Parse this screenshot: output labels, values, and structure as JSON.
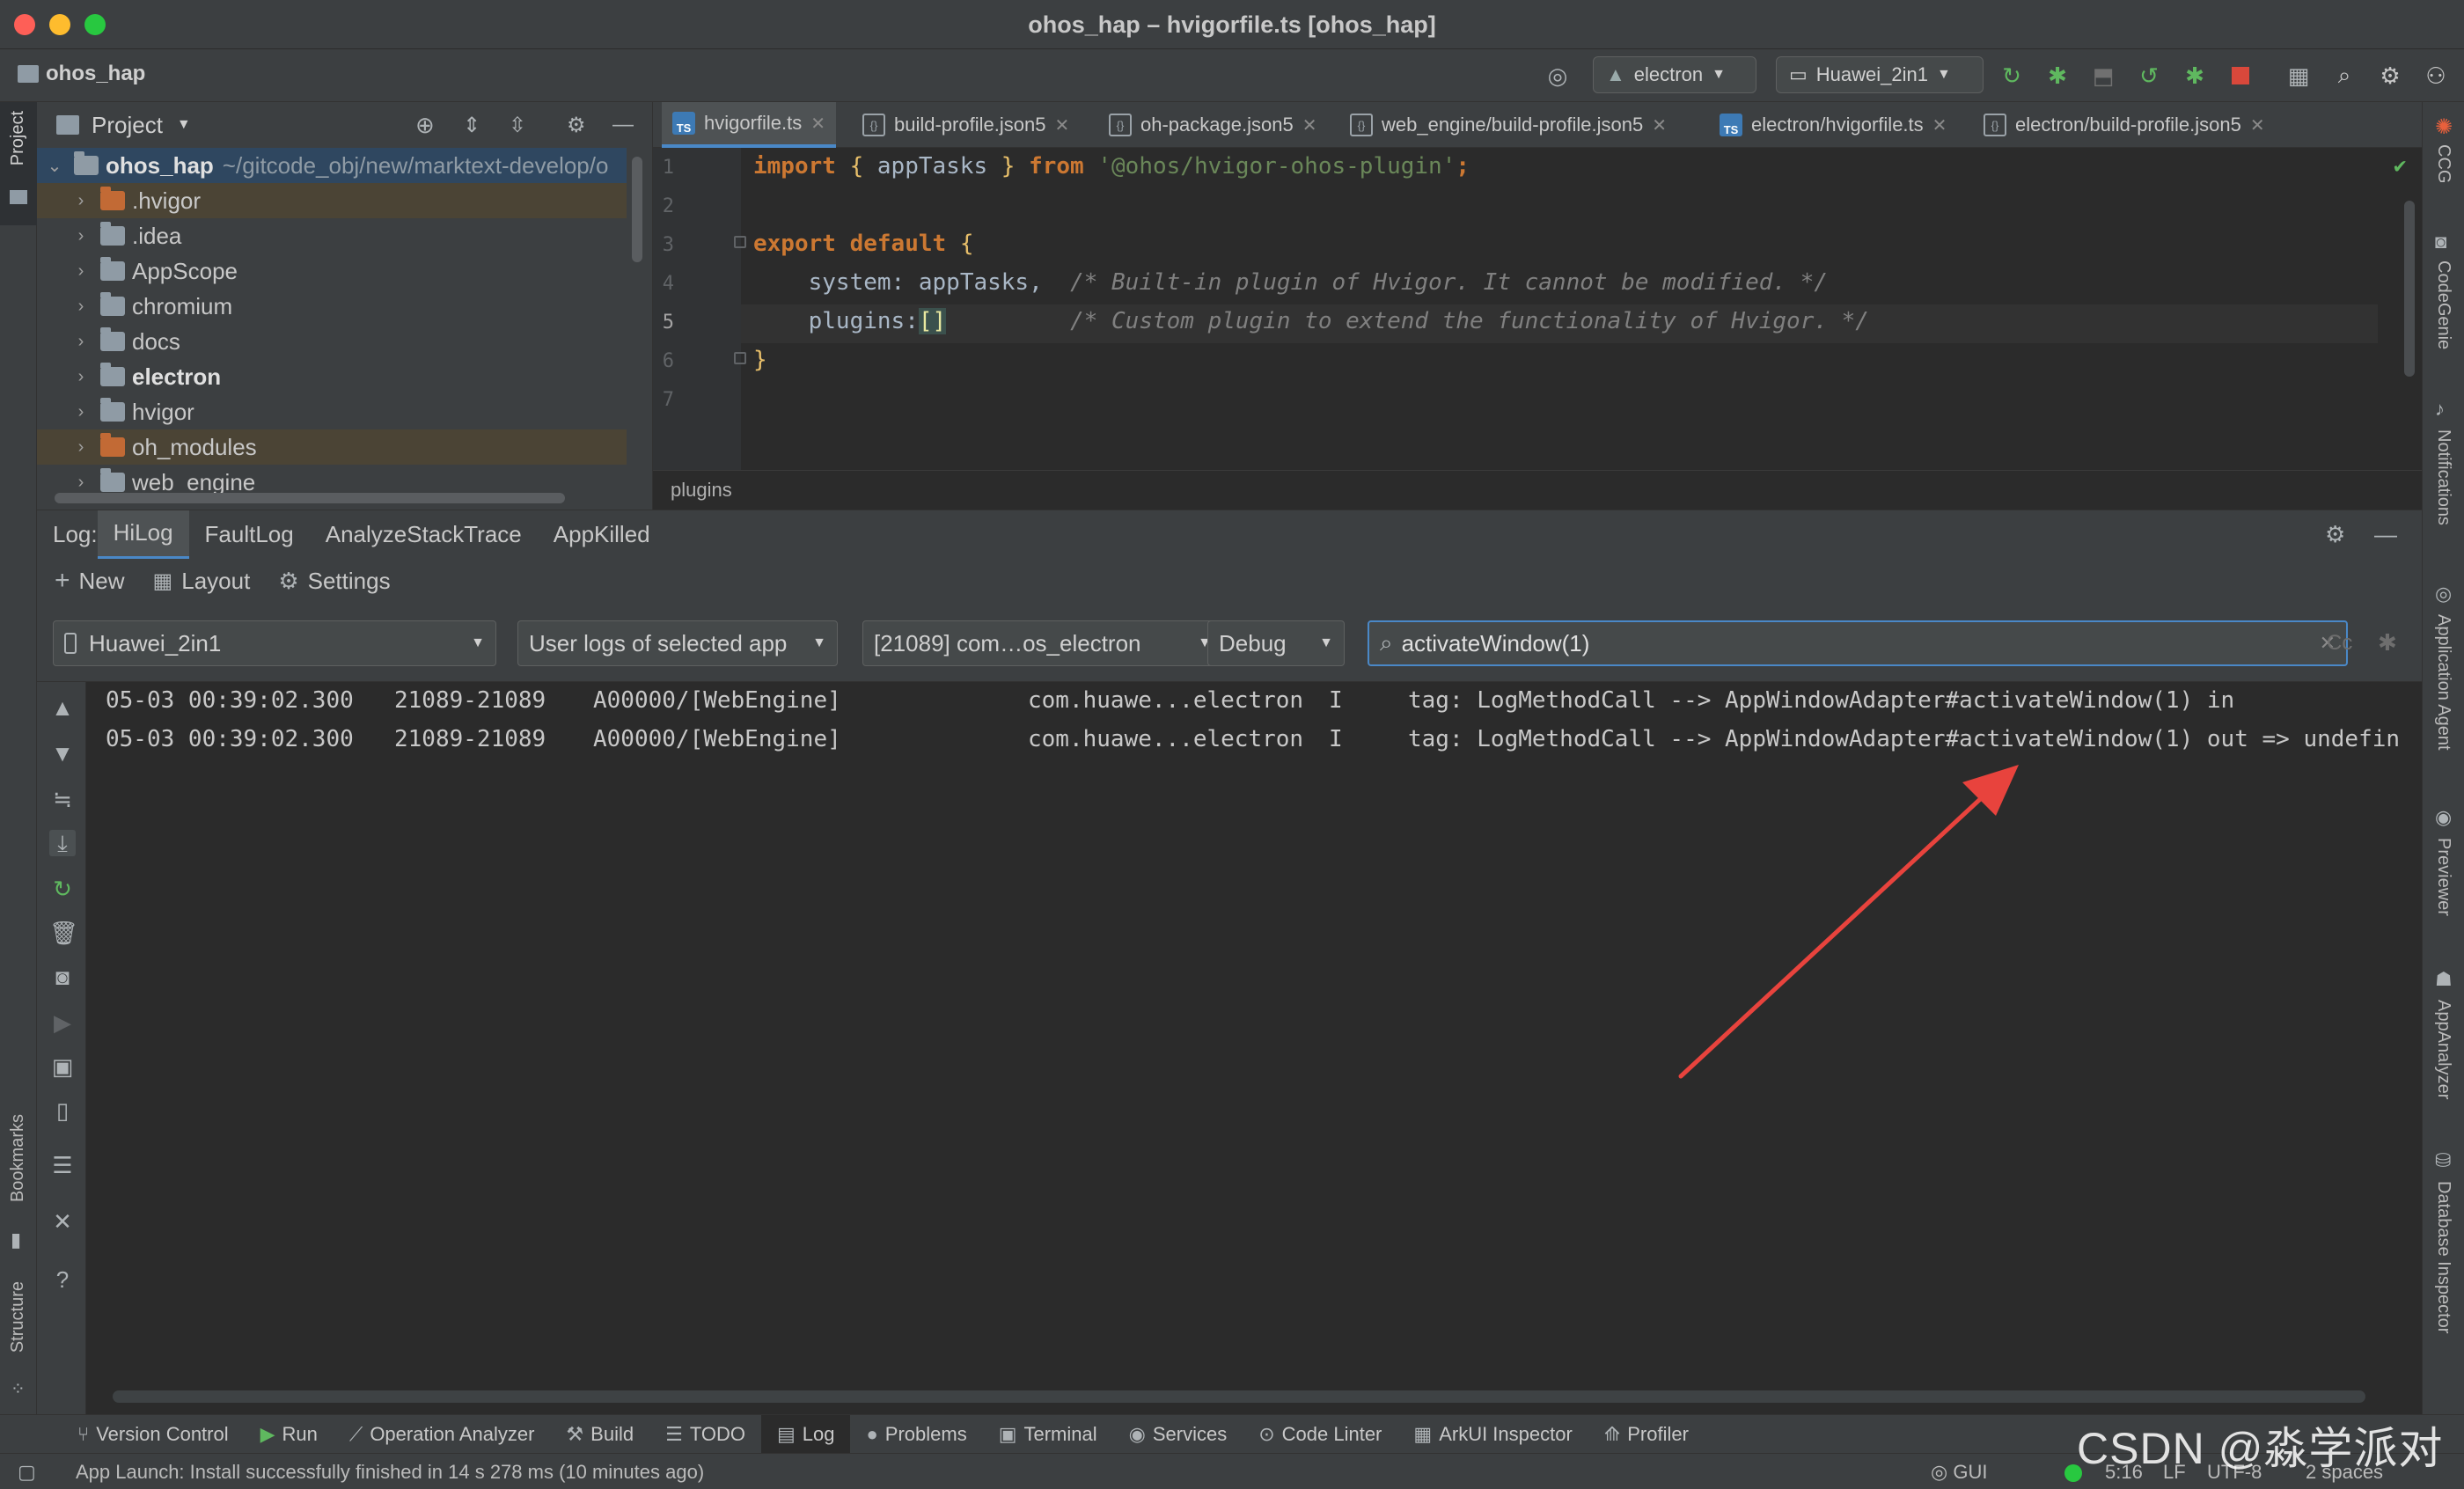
{
  "window": {
    "title": "ohos_hap – hvigorfile.ts [ohos_hap]"
  },
  "navbar": {
    "project": "ohos_hap",
    "run_config": "electron",
    "device": "Huawei_2in1"
  },
  "left_strip": {
    "project_label": "Project",
    "bookmarks_label": "Bookmarks",
    "structure_label": "Structure"
  },
  "right_strip": {
    "items": [
      "CCG",
      "CodeGenie",
      "Notifications",
      "Application Agent",
      "Previewer",
      "AppAnalyzer",
      "Database Inspector"
    ]
  },
  "project_panel": {
    "title": "Project",
    "root_name": "ohos_hap",
    "root_path": "~/gitcode_obj/new/marktext-develop/o",
    "items": [
      {
        "label": ".hvigor",
        "bold": false
      },
      {
        "label": ".idea",
        "bold": false
      },
      {
        "label": "AppScope",
        "bold": false
      },
      {
        "label": "chromium",
        "bold": false
      },
      {
        "label": "docs",
        "bold": false
      },
      {
        "label": "electron",
        "bold": true
      },
      {
        "label": "hvigor",
        "bold": false
      },
      {
        "label": "oh_modules",
        "bold": false
      },
      {
        "label": "web_engine",
        "bold": false
      }
    ]
  },
  "editor_tabs": [
    "hvigorfile.ts",
    "build-profile.json5",
    "oh-package.json5",
    "web_engine/build-profile.json5",
    "electron/hvigorfile.ts",
    "electron/build-profile.json5"
  ],
  "editor": {
    "line_numbers": [
      "1",
      "2",
      "3",
      "4",
      "5",
      "6",
      "7"
    ],
    "line1": {
      "kw1": "import",
      "ob": "{",
      "name": "appTasks",
      "cb": "}",
      "kw2": "from",
      "str": "'@ohos/hvigor-ohos-plugin'",
      "end": ";"
    },
    "line3": {
      "kw1": "export",
      "kw2": "default",
      "ob": "{"
    },
    "line4": {
      "key": "system",
      "colon": ":",
      "val": "appTasks,",
      "comment": "/* Built-in plugin of Hvigor. It cannot be modified. */"
    },
    "line5": {
      "key": "plugins",
      "colon": ":",
      "val": "[]",
      "comment": "/* Custom plugin to extend the functionality of Hvigor. */"
    },
    "line6": {
      "cb": "}"
    },
    "breadcrumb": "plugins"
  },
  "log": {
    "label": "Log:",
    "tabs": [
      "HiLog",
      "FaultLog",
      "AnalyzeStackTrace",
      "AppKilled"
    ],
    "toolbar": {
      "new": "New",
      "layout": "Layout",
      "settings": "Settings"
    },
    "filters": {
      "device": "Huawei_2in1",
      "scope": "User logs of selected app",
      "process": "[21089] com…os_electron",
      "level": "Debug",
      "search": "activateWindow(1)",
      "case_toggle": "Cc"
    },
    "lines": [
      {
        "time": "05-03 00:39:02.300",
        "pid": "21089-21089",
        "domain": "A00000/[WebEngine]",
        "pkg": "com.huawe...electron",
        "level": "I",
        "msg": "tag: LogMethodCall --> AppWindowAdapter#activateWindow(1) in"
      },
      {
        "time": "05-03 00:39:02.300",
        "pid": "21089-21089",
        "domain": "A00000/[WebEngine]",
        "pkg": "com.huawe...electron",
        "level": "I",
        "msg": "tag: LogMethodCall --> AppWindowAdapter#activateWindow(1) out => undefin"
      }
    ]
  },
  "bottom_bar": [
    {
      "label": "Version Control",
      "icon": "branch-icon"
    },
    {
      "label": "Run",
      "icon": "play-icon"
    },
    {
      "label": "Operation Analyzer",
      "icon": "chart-icon"
    },
    {
      "label": "Build",
      "icon": "hammer-icon"
    },
    {
      "label": "TODO",
      "icon": "list-icon"
    },
    {
      "label": "Log",
      "icon": "log-icon"
    },
    {
      "label": "Problems",
      "icon": "info-icon"
    },
    {
      "label": "Terminal",
      "icon": "terminal-icon"
    },
    {
      "label": "Services",
      "icon": "services-icon"
    },
    {
      "label": "Code Linter",
      "icon": "linter-icon"
    },
    {
      "label": "ArkUI Inspector",
      "icon": "inspector-icon"
    },
    {
      "label": "Profiler",
      "icon": "profiler-icon"
    }
  ],
  "status": {
    "message": "App Launch: Install successfully finished in 14 s 278 ms (10 minutes ago)",
    "gui": "GUI",
    "position": "5:16",
    "line_sep": "LF",
    "encoding": "UTF-8",
    "indent": "2 spaces"
  },
  "watermark": "CSDN @淼学派对",
  "colors": {
    "accent": "#4a88c7",
    "keyword": "#cc7832",
    "string": "#6a8759",
    "arrow": "#e8433d"
  }
}
